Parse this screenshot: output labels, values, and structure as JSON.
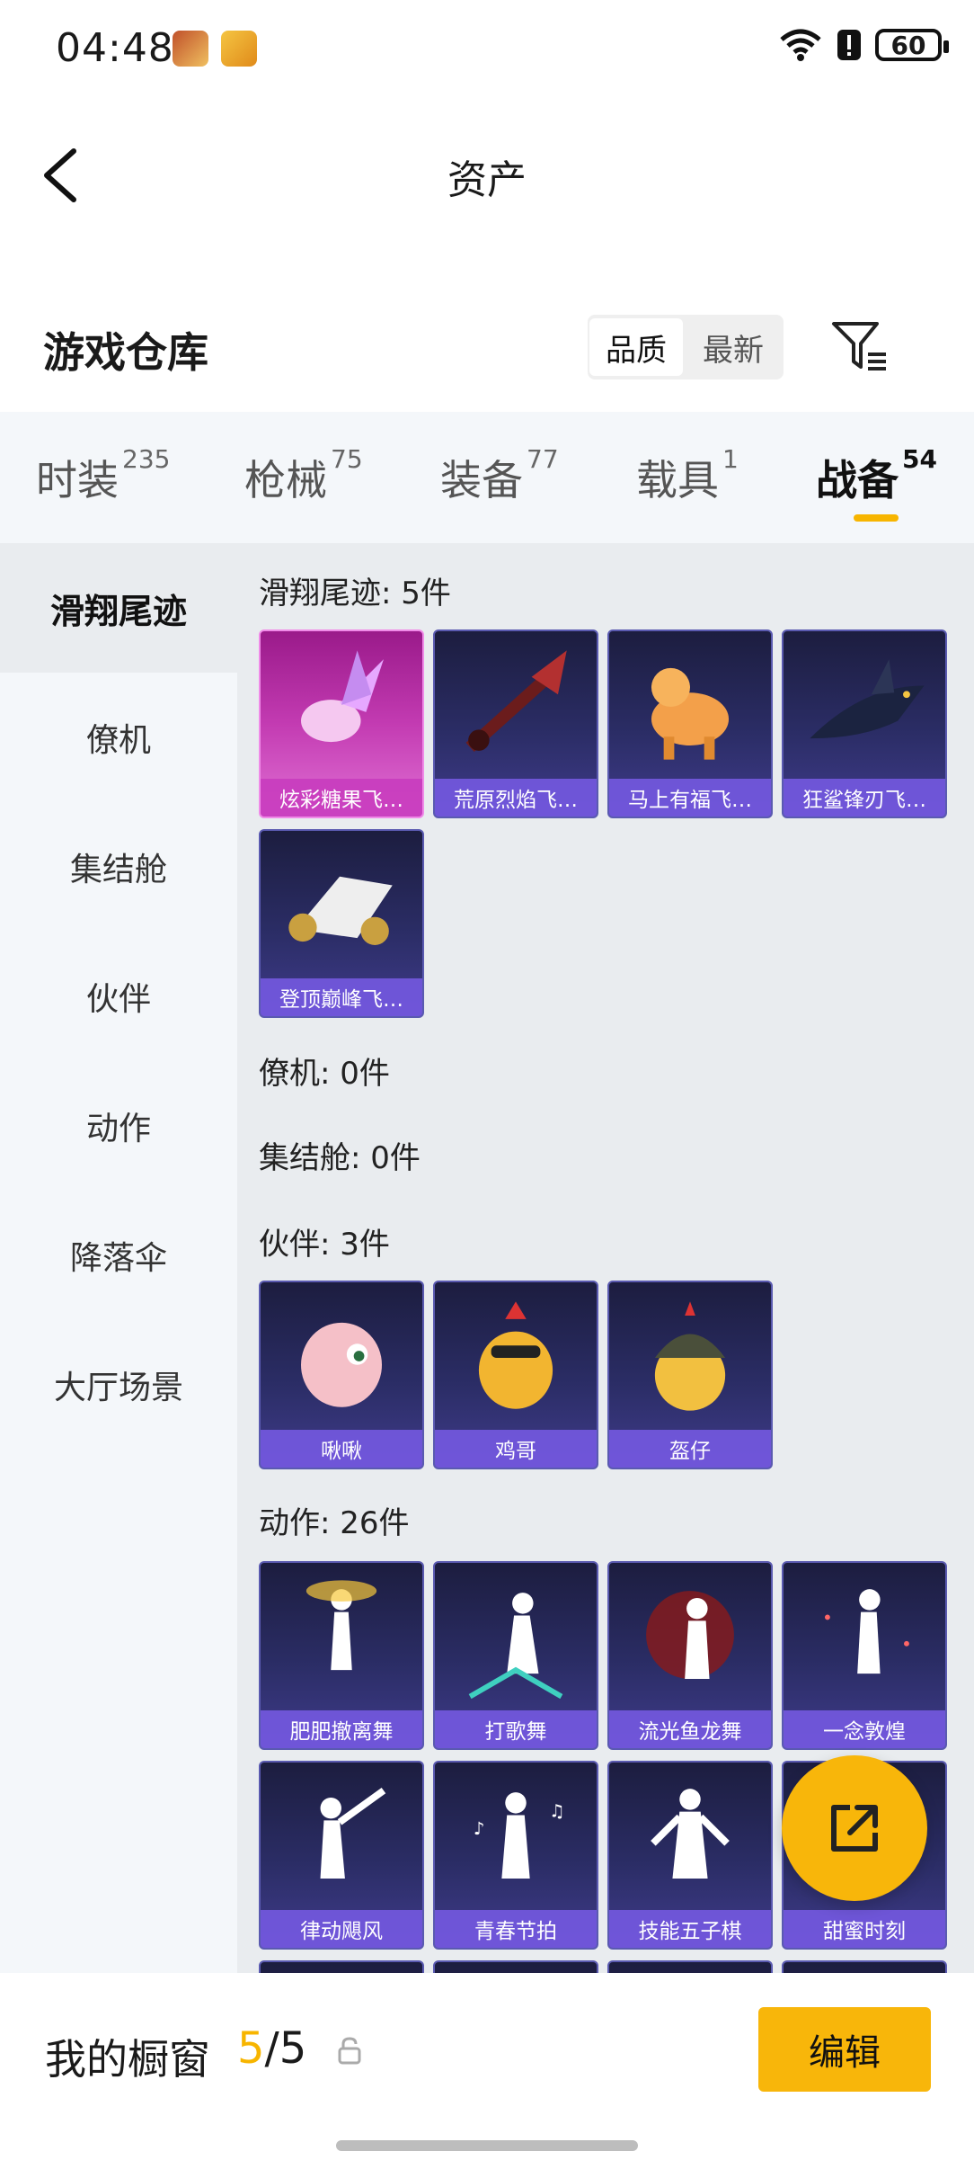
{
  "status": {
    "time": "04:48",
    "battery": "60"
  },
  "header": {
    "title": "资产"
  },
  "section": {
    "title": "游戏仓库",
    "sort": [
      "品质",
      "最新"
    ]
  },
  "tabs": [
    {
      "label": "时装",
      "count": "235"
    },
    {
      "label": "枪械",
      "count": "75"
    },
    {
      "label": "装备",
      "count": "77"
    },
    {
      "label": "载具",
      "count": "1"
    },
    {
      "label": "战备",
      "count": "54"
    }
  ],
  "sidebar": [
    "滑翔尾迹",
    "僚机",
    "集结舱",
    "伙伴",
    "动作",
    "降落伞",
    "大厅场景"
  ],
  "groups": {
    "glide": {
      "title": "滑翔尾迹: 5件",
      "items": [
        "炫彩糖果飞…",
        "荒原烈焰飞…",
        "马上有福飞…",
        "狂鲨锋刃飞…",
        "登顶巅峰飞…"
      ]
    },
    "wingman": {
      "title": "僚机: 0件"
    },
    "capsule": {
      "title": "集结舱: 0件"
    },
    "partner": {
      "title": "伙伴: 3件",
      "items": [
        "啾啾",
        "鸡哥",
        "盔仔"
      ]
    },
    "action": {
      "title": "动作: 26件",
      "items": [
        "肥肥撤离舞",
        "打歌舞",
        "流光鱼龙舞",
        "一念敦煌",
        "律动飓风",
        "青春节拍",
        "技能五子棋",
        "甜蜜时刻"
      ]
    }
  },
  "bottom": {
    "title": "我的橱窗",
    "count_current": "5",
    "count_total": "/5",
    "edit": "编辑"
  }
}
